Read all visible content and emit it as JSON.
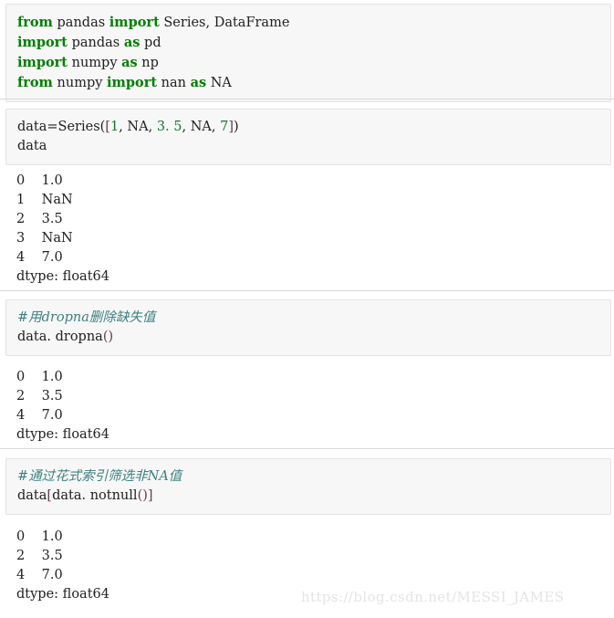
{
  "notebook": {
    "cells": [
      {
        "id": "cell-imports",
        "type": "code",
        "lines": [
          [
            {
              "t": "from",
              "c": "kw"
            },
            {
              "t": " pandas ",
              "c": "plain"
            },
            {
              "t": "import",
              "c": "kw"
            },
            {
              "t": " Series, DataFrame",
              "c": "plain"
            }
          ],
          [
            {
              "t": "import",
              "c": "kw"
            },
            {
              "t": " pandas ",
              "c": "plain"
            },
            {
              "t": "as",
              "c": "kw"
            },
            {
              "t": " pd",
              "c": "plain"
            }
          ],
          [
            {
              "t": "import",
              "c": "kw"
            },
            {
              "t": " numpy ",
              "c": "plain"
            },
            {
              "t": "as",
              "c": "kw"
            },
            {
              "t": " np",
              "c": "plain"
            }
          ],
          [
            {
              "t": "from",
              "c": "kw"
            },
            {
              "t": " numpy ",
              "c": "plain"
            },
            {
              "t": "import",
              "c": "kw"
            },
            {
              "t": " nan ",
              "c": "plain"
            },
            {
              "t": "as",
              "c": "kw"
            },
            {
              "t": " NA",
              "c": "plain"
            }
          ]
        ]
      },
      {
        "id": "cell-create-series",
        "type": "code",
        "lines": [
          [
            {
              "t": "data=Series(",
              "c": "plain"
            },
            {
              "t": "[",
              "c": "brk"
            },
            {
              "t": "1",
              "c": "num"
            },
            {
              "t": ", NA, ",
              "c": "plain"
            },
            {
              "t": "3. 5",
              "c": "num"
            },
            {
              "t": ", NA, ",
              "c": "plain"
            },
            {
              "t": "7",
              "c": "num"
            },
            {
              "t": "]",
              "c": "brk"
            },
            {
              "t": ")",
              "c": "plain"
            }
          ],
          [
            {
              "t": "data",
              "c": "plain"
            }
          ]
        ]
      },
      {
        "id": "cell-dropna",
        "type": "code",
        "lines": [
          [
            {
              "t": "#用dropna删除缺失值",
              "c": "cmt"
            }
          ],
          [
            {
              "t": "data. dropna",
              "c": "plain"
            },
            {
              "t": "()",
              "c": "brk"
            }
          ]
        ]
      },
      {
        "id": "cell-notnull",
        "type": "code",
        "lines": [
          [
            {
              "t": "#通过花式索引筛选非NA值",
              "c": "cmt"
            }
          ],
          [
            {
              "t": "data",
              "c": "plain"
            },
            {
              "t": "[",
              "c": "brk"
            },
            {
              "t": "data. notnu",
              "c": "plain"
            },
            {
              "t": "ll",
              "c": "plain"
            },
            {
              "t": "()",
              "c": "brk"
            },
            {
              "t": "]",
              "c": "brk"
            }
          ]
        ]
      }
    ],
    "outputs": [
      {
        "id": "output-series",
        "lines": [
          "0    1.0",
          "1    NaN",
          "2    3.5",
          "3    NaN",
          "4    7.0",
          "dtype: float64"
        ]
      },
      {
        "id": "output-dropna",
        "lines": [
          "0    1.0",
          "2    3.5",
          "4    7.0",
          "dtype: float64"
        ]
      },
      {
        "id": "output-notnull",
        "lines": [
          "0    1.0",
          "2    3.5",
          "4    7.0",
          "dtype: float64"
        ]
      }
    ],
    "watermark": "https://blog.csdn.net/MESSI_JAMES"
  },
  "colors": {
    "keyword": "#007f00",
    "number": "#0d7a2e",
    "comment": "#3f8080",
    "bracket": "#6b3a52",
    "text": "#202020",
    "cell_background": "#f7f7f7",
    "cell_border": "#e3e3e3",
    "separator": "#d8d8d8",
    "watermark": "#e6e4e2",
    "page_background": "#ffffff"
  }
}
